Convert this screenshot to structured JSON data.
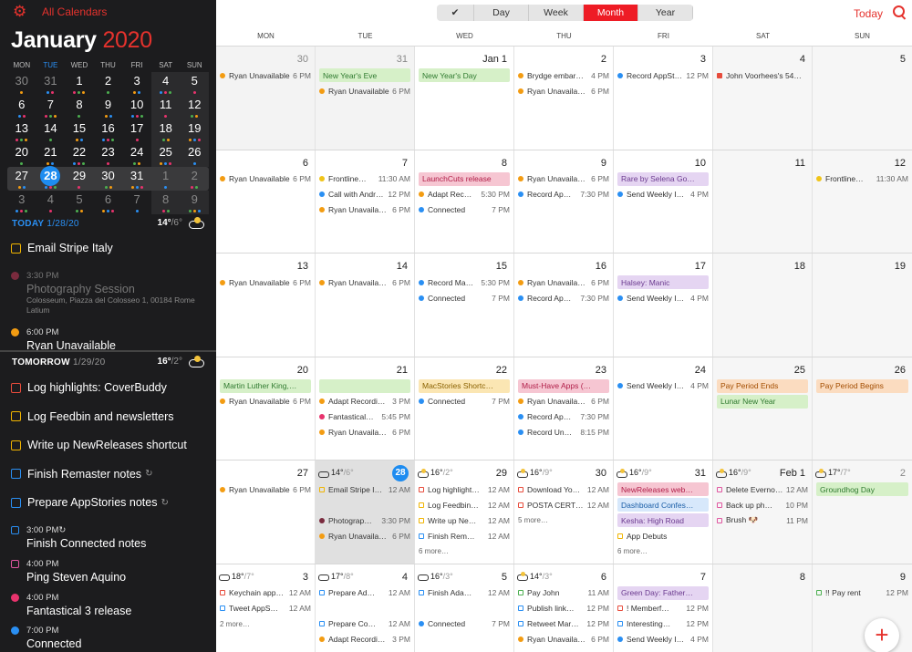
{
  "sidebar": {
    "all_calendars": "All Calendars",
    "month": "January",
    "year": "2020",
    "dows": [
      "MON",
      "TUE",
      "WED",
      "THU",
      "FRI",
      "SAT",
      "SUN"
    ],
    "weeks": [
      {
        "days": [
          "30",
          "31",
          "1",
          "2",
          "3",
          "4",
          "5"
        ],
        "dim": [
          true,
          true,
          false,
          false,
          false,
          false,
          false
        ]
      },
      {
        "days": [
          "6",
          "7",
          "8",
          "9",
          "10",
          "11",
          "12"
        ]
      },
      {
        "days": [
          "13",
          "14",
          "15",
          "16",
          "17",
          "18",
          "19"
        ]
      },
      {
        "days": [
          "20",
          "21",
          "22",
          "23",
          "24",
          "25",
          "26"
        ]
      },
      {
        "days": [
          "27",
          "28",
          "29",
          "30",
          "31",
          "1",
          "2"
        ],
        "dim": [
          false,
          false,
          false,
          false,
          false,
          true,
          true
        ],
        "selected": true
      },
      {
        "days": [
          "3",
          "4",
          "5",
          "6",
          "7",
          "8",
          "9"
        ],
        "dim": [
          true,
          true,
          true,
          true,
          true,
          true,
          true
        ]
      }
    ],
    "today": {
      "label": "TODAY",
      "date": "1/28/20",
      "hi": "14°",
      "lo": "/6°"
    },
    "today_items": [
      {
        "kind": "task",
        "title": "Email Stripe Italy",
        "color": "#f0b400"
      },
      {
        "kind": "event",
        "time": "3:30 PM",
        "title": "Photography Session",
        "sub": "Colosseum, Piazza del Colosseo 1, 00184 Rome Latium",
        "color": "#7a2b3e",
        "faded": true
      },
      {
        "kind": "event",
        "time": "6:00 PM",
        "title": "Ryan Unavailable",
        "color": "#f39c12"
      }
    ],
    "tomorrow": {
      "label": "TOMORROW",
      "date": "1/29/20",
      "hi": "16°",
      "lo": "/2°"
    },
    "tomorrow_items": [
      {
        "kind": "task",
        "title": "Log highlights: CoverBuddy",
        "color": "#e74c3c"
      },
      {
        "kind": "task",
        "title": "Log Feedbin and newsletters",
        "color": "#f0b400"
      },
      {
        "kind": "task",
        "title": "Write up NewReleases shortcut",
        "color": "#f0b400"
      },
      {
        "kind": "task",
        "title": "Finish Remaster notes",
        "color": "#2a8ff3",
        "rep": true
      },
      {
        "kind": "task",
        "title": "Prepare AppStories notes",
        "color": "#2a8ff3",
        "rep": true
      },
      {
        "kind": "ttask",
        "time": "3:00 PM",
        "title": "Finish Connected notes",
        "color": "#2a8ff3",
        "rep": true
      },
      {
        "kind": "ttask",
        "time": "4:00 PM",
        "title": "Ping Steven Aquino",
        "color": "#e056a0"
      },
      {
        "kind": "event",
        "time": "4:00 PM",
        "title": "Fantastical 3 release",
        "color": "#e8336d"
      },
      {
        "kind": "event",
        "time": "7:00 PM",
        "title": "Connected",
        "color": "#2a8ff3"
      }
    ]
  },
  "toolbar": {
    "views": [
      "Day",
      "Week",
      "Month",
      "Year"
    ],
    "selected": "Month",
    "today": "Today"
  },
  "grid": {
    "dows": [
      "MON",
      "TUE",
      "WED",
      "THU",
      "FRI",
      "SAT",
      "SUN"
    ],
    "weeks": [
      [
        {
          "n": "30",
          "dim": true,
          "past": true,
          "ev": [
            {
              "t": "Ryan Unavailable",
              "tm": "6 PM",
              "c": "#f39c12"
            }
          ]
        },
        {
          "n": "31",
          "dim": true,
          "past": true,
          "ev": [
            {
              "t": "New Year's Eve",
              "bar": "#d6f0c8",
              "tc": "#2f7a2f"
            },
            {
              "t": "Ryan Unavailable",
              "tm": "6 PM",
              "c": "#f39c12"
            }
          ]
        },
        {
          "n": "Jan 1",
          "ev": [
            {
              "t": "New Year's Day",
              "bar": "#d6f0c8",
              "tc": "#2f7a2f"
            }
          ]
        },
        {
          "n": "2",
          "ev": [
            {
              "t": "Brydge embar…",
              "tm": "4 PM",
              "c": "#f39c12"
            },
            {
              "t": "Ryan Unavaila…",
              "tm": "6 PM",
              "c": "#f39c12"
            }
          ]
        },
        {
          "n": "3",
          "ev": [
            {
              "t": "Record AppSt…",
              "tm": "12 PM",
              "c": "#2a8ff3"
            }
          ]
        },
        {
          "n": "4",
          "we": true,
          "ev": [
            {
              "t": "John Voorhees's 54…",
              "c": "#e74c3c",
              "sq": true
            }
          ]
        },
        {
          "n": "5",
          "we": true,
          "ev": []
        }
      ],
      [
        {
          "n": "6",
          "ev": [
            {
              "t": "Ryan Unavailable",
              "tm": "6 PM",
              "c": "#f39c12"
            }
          ]
        },
        {
          "n": "7",
          "ev": [
            {
              "t": "Frontline…",
              "tm": "11:30 AM",
              "c": "#f0c419"
            },
            {
              "t": "Call with Andr…",
              "tm": "12 PM",
              "c": "#2a8ff3"
            },
            {
              "t": "Ryan Unavaila…",
              "tm": "6 PM",
              "c": "#f39c12"
            }
          ]
        },
        {
          "n": "8",
          "ev": [
            {
              "t": "LaunchCuts release",
              "bar": "#f6c6d2",
              "tc": "#b01c47"
            },
            {
              "t": "Adapt Rec…",
              "tm": "5:30 PM",
              "c": "#f39c12"
            },
            {
              "t": "Connected",
              "tm": "7 PM",
              "c": "#2a8ff3"
            }
          ]
        },
        {
          "n": "9",
          "ev": [
            {
              "t": "Ryan Unavaila…",
              "tm": "6 PM",
              "c": "#f39c12"
            },
            {
              "t": "Record Ap…",
              "tm": "7:30 PM",
              "c": "#2a8ff3"
            }
          ]
        },
        {
          "n": "10",
          "ev": [
            {
              "t": "Rare by Selena Go…",
              "bar": "#e5d5f2",
              "tc": "#6b3a8f"
            },
            {
              "t": "Send Weekly I…",
              "tm": "4 PM",
              "c": "#2a8ff3"
            }
          ]
        },
        {
          "n": "11",
          "we": true,
          "ev": []
        },
        {
          "n": "12",
          "we": true,
          "ev": [
            {
              "t": "Frontline…",
              "tm": "11:30 AM",
              "c": "#f0c419"
            }
          ]
        }
      ],
      [
        {
          "n": "13",
          "ev": [
            {
              "t": "Ryan Unavailable",
              "tm": "6 PM",
              "c": "#f39c12"
            }
          ]
        },
        {
          "n": "14",
          "ev": [
            {
              "t": "Ryan Unavaila…",
              "tm": "6 PM",
              "c": "#f39c12"
            }
          ]
        },
        {
          "n": "15",
          "ev": [
            {
              "t": "Record Ma…",
              "tm": "5:30 PM",
              "c": "#2a8ff3"
            },
            {
              "t": "Connected",
              "tm": "7 PM",
              "c": "#2a8ff3"
            }
          ]
        },
        {
          "n": "16",
          "ev": [
            {
              "t": "Ryan Unavaila…",
              "tm": "6 PM",
              "c": "#f39c12"
            },
            {
              "t": "Record Ap…",
              "tm": "7:30 PM",
              "c": "#2a8ff3"
            }
          ]
        },
        {
          "n": "17",
          "ev": [
            {
              "t": "Halsey: Manic",
              "bar": "#e5d5f2",
              "tc": "#6b3a8f"
            },
            {
              "t": "Send Weekly I…",
              "tm": "4 PM",
              "c": "#2a8ff3"
            }
          ]
        },
        {
          "n": "18",
          "we": true,
          "ev": []
        },
        {
          "n": "19",
          "we": true,
          "ev": []
        }
      ],
      [
        {
          "n": "20",
          "ev": [
            {
              "t": "Martin Luther King,…",
              "bar": "#d6f0c8",
              "tc": "#2f7a2f"
            },
            {
              "t": "Ryan Unavailable",
              "tm": "6 PM",
              "c": "#f39c12"
            }
          ]
        },
        {
          "n": "21",
          "ev": [
            {
              "t": "",
              "bar": "#d6f0c8"
            },
            {
              "t": "Adapt Recordi…",
              "tm": "3 PM",
              "c": "#f39c12"
            },
            {
              "t": "Fantastical…",
              "tm": "5:45 PM",
              "c": "#e8336d"
            },
            {
              "t": "Ryan Unavaila…",
              "tm": "6 PM",
              "c": "#f39c12"
            }
          ]
        },
        {
          "n": "22",
          "ev": [
            {
              "t": "MacStories Shortc…",
              "bar": "#fbe6b3",
              "tc": "#8a6100"
            },
            {
              "t": "Connected",
              "tm": "7 PM",
              "c": "#2a8ff3"
            }
          ]
        },
        {
          "n": "23",
          "ev": [
            {
              "t": "Must-Have Apps (…",
              "bar": "#f6c6d2",
              "tc": "#b01c47"
            },
            {
              "t": "Ryan Unavaila…",
              "tm": "6 PM",
              "c": "#f39c12"
            },
            {
              "t": "Record Ap…",
              "tm": "7:30 PM",
              "c": "#2a8ff3"
            },
            {
              "t": "Record Un…",
              "tm": "8:15 PM",
              "c": "#2a8ff3"
            }
          ]
        },
        {
          "n": "24",
          "ev": [
            {
              "t": "Send Weekly I…",
              "tm": "4 PM",
              "c": "#2a8ff3"
            }
          ]
        },
        {
          "n": "25",
          "we": true,
          "ev": [
            {
              "t": "Pay Period Ends",
              "bar": "#fbdcc0",
              "tc": "#a34d00"
            },
            {
              "t": "Lunar New Year",
              "bar": "#d6f0c8",
              "tc": "#2f7a2f"
            }
          ]
        },
        {
          "n": "26",
          "we": true,
          "ev": [
            {
              "t": "Pay Period Begins",
              "bar": "#fbdcc0",
              "tc": "#a34d00"
            }
          ]
        }
      ],
      [
        {
          "n": "27",
          "ev": [
            {
              "t": "Ryan Unavailable",
              "tm": "6 PM",
              "c": "#f39c12"
            }
          ]
        },
        {
          "n": "28",
          "today": true,
          "wx": {
            "hi": "14°",
            "lo": "/6°",
            "sun": false
          },
          "ev": [
            {
              "t": "Email Stripe I…",
              "tm": "12 AM",
              "cb": "#f0b400"
            },
            {
              "t": ""
            },
            {
              "t": "Photograp…",
              "tm": "3:30 PM",
              "c": "#7a2b3e"
            },
            {
              "t": "Ryan Unavaila…",
              "tm": "6 PM",
              "c": "#f39c12"
            }
          ]
        },
        {
          "n": "29",
          "wx": {
            "hi": "16°",
            "lo": "/2°",
            "sun": true
          },
          "ev": [
            {
              "t": "Log highlight…",
              "tm": "12 AM",
              "cb": "#e74c3c"
            },
            {
              "t": "Log Feedbin…",
              "tm": "12 AM",
              "cb": "#f0b400"
            },
            {
              "t": "Write up Ne…",
              "tm": "12 AM",
              "cb": "#f0b400"
            },
            {
              "t": "Finish Rem…",
              "tm": "12 AM",
              "cb": "#2a8ff3"
            },
            {
              "t": "6 more…",
              "more": true
            }
          ]
        },
        {
          "n": "30",
          "wx": {
            "hi": "16°",
            "lo": "/9°",
            "sun": true
          },
          "ev": [
            {
              "t": "Download Yo…",
              "tm": "12 AM",
              "cb": "#e74c3c"
            },
            {
              "t": "POSTA CERT…",
              "tm": "12 AM",
              "cb": "#e74c3c"
            },
            {
              "t": "5 more…",
              "more": true
            }
          ]
        },
        {
          "n": "31",
          "wx": {
            "hi": "16°",
            "lo": "/9°",
            "sun": true
          },
          "ev": [
            {
              "t": "NewReleases web…",
              "bar": "#f6c6d2",
              "tc": "#b01c47"
            },
            {
              "t": "Dashboard Confes…",
              "bar": "#d7e8fb",
              "tc": "#1c5fa8"
            },
            {
              "t": "Kesha: High Road",
              "bar": "#e5d5f2",
              "tc": "#6b3a8f"
            },
            {
              "t": "App Debuts",
              "cb": "#f0b400"
            },
            {
              "t": "6 more…",
              "more": true
            }
          ]
        },
        {
          "n": "Feb 1",
          "we": true,
          "wx": {
            "hi": "16°",
            "lo": "/9°",
            "sun": true
          },
          "ev": [
            {
              "t": "Delete Everno…",
              "tm": "12 AM",
              "cb": "#e056a0"
            },
            {
              "t": "Back up ph…",
              "tm": "10 PM",
              "cb": "#e056a0"
            },
            {
              "t": "Brush 🐶",
              "tm": "11 PM",
              "cb": "#e056a0"
            }
          ]
        },
        {
          "n": "2",
          "we": true,
          "dim": true,
          "wx": {
            "hi": "17°",
            "lo": "/7°",
            "sun": true
          },
          "ev": [
            {
              "t": "Groundhog Day",
              "bar": "#d6f0c8",
              "tc": "#2f7a2f"
            }
          ]
        }
      ],
      [
        {
          "n": "3",
          "wx": {
            "hi": "18°",
            "lo": "/7°",
            "sun": false
          },
          "ev": [
            {
              "t": "Keychain app…",
              "tm": "12 AM",
              "cb": "#e74c3c"
            },
            {
              "t": "Tweet AppS…",
              "tm": "12 AM",
              "cb": "#2a8ff3"
            },
            {
              "t": "2 more…",
              "more": true
            }
          ]
        },
        {
          "n": "4",
          "wx": {
            "hi": "17°",
            "lo": "/8°",
            "sun": false
          },
          "ev": [
            {
              "t": "Prepare Ad…",
              "tm": "12 AM",
              "cb": "#2a8ff3"
            },
            {
              "t": ""
            },
            {
              "t": "Prepare Co…",
              "tm": "12 AM",
              "cb": "#2a8ff3"
            },
            {
              "t": "Adapt Recordi…",
              "tm": "3 PM",
              "c": "#f39c12"
            }
          ]
        },
        {
          "n": "5",
          "wx": {
            "hi": "16°",
            "lo": "/3°",
            "sun": false
          },
          "ev": [
            {
              "t": "Finish Ada…",
              "tm": "12 AM",
              "cb": "#2a8ff3"
            },
            {
              "t": ""
            },
            {
              "t": "Connected",
              "tm": "7 PM",
              "c": "#2a8ff3"
            }
          ]
        },
        {
          "n": "6",
          "wx": {
            "hi": "14°",
            "lo": "/3°",
            "sun": true
          },
          "ev": [
            {
              "t": "Pay John",
              "tm": "11 AM",
              "cb": "#4caf50"
            },
            {
              "t": "Publish link…",
              "tm": "12 PM",
              "cb": "#2a8ff3"
            },
            {
              "t": "Retweet Mar…",
              "tm": "12 PM",
              "cb": "#2a8ff3"
            },
            {
              "t": "Ryan Unavaila…",
              "tm": "6 PM",
              "c": "#f39c12"
            }
          ]
        },
        {
          "n": "7",
          "ev": [
            {
              "t": "Green Day: Father…",
              "bar": "#e5d5f2",
              "tc": "#6b3a8f"
            },
            {
              "t": "! Memberf…",
              "tm": "12 PM",
              "cb": "#e74c3c"
            },
            {
              "t": "Interesting…",
              "tm": "12 PM",
              "cb": "#2a8ff3"
            },
            {
              "t": "Send Weekly I…",
              "tm": "4 PM",
              "c": "#2a8ff3"
            }
          ]
        },
        {
          "n": "8",
          "we": true,
          "ev": []
        },
        {
          "n": "9",
          "we": true,
          "ev": [
            {
              "t": "!! Pay rent",
              "tm": "12 PM",
              "cb": "#4caf50"
            }
          ]
        }
      ]
    ]
  },
  "fab": "+"
}
